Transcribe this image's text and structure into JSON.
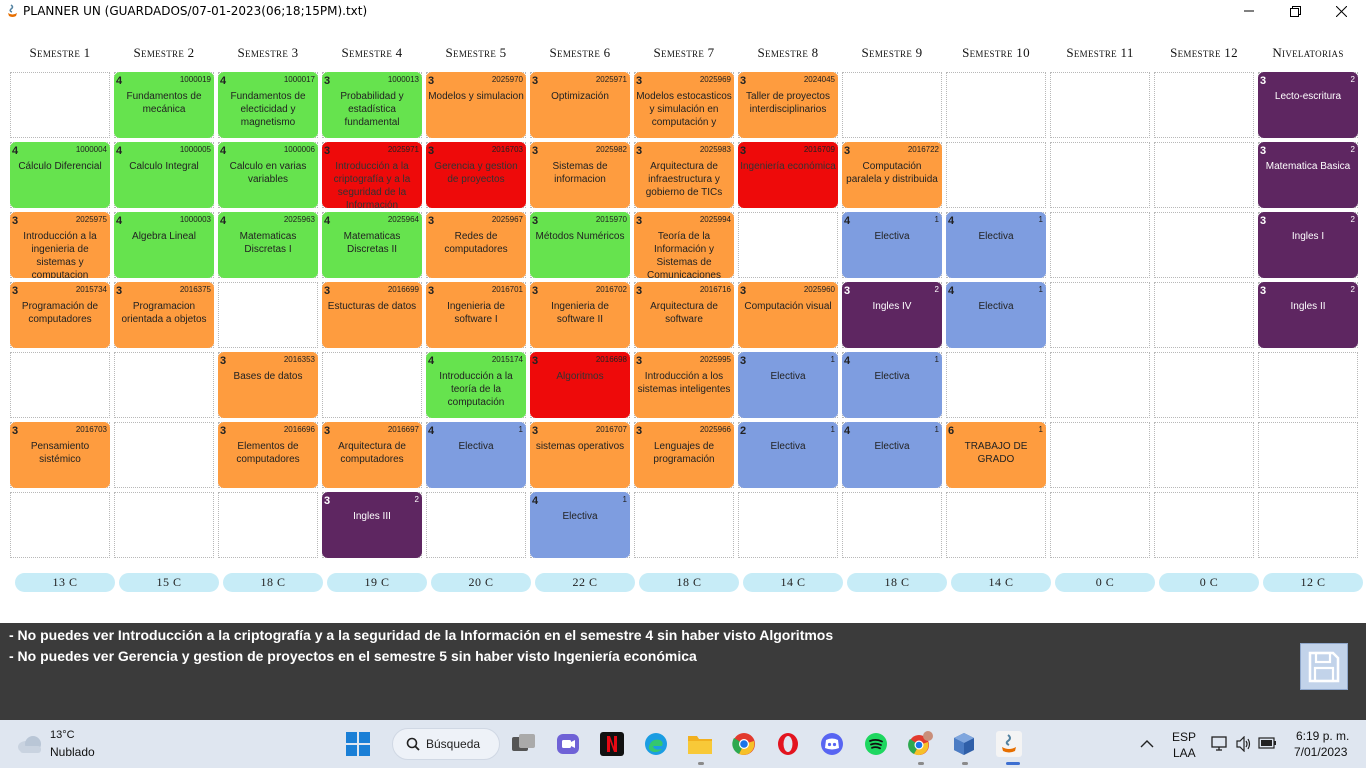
{
  "window": {
    "title": "PLANNER UN (GUARDADOS/07-01-2023(06;18;15PM).txt)"
  },
  "colors": {
    "green": "#66e34e",
    "orange": "#fe9c3f",
    "red": "#ee0a0a",
    "blue": "#7e9de0",
    "purple": "#5e2661",
    "pill": "#c7ecf7",
    "panel": "#3b3b3b"
  },
  "semesters": [
    "Semestre 1",
    "Semestre 2",
    "Semestre 3",
    "Semestre 4",
    "Semestre 5",
    "Semestre 6",
    "Semestre 7",
    "Semestre 8",
    "Semestre 9",
    "Semestre 10",
    "Semestre 11",
    "Semestre 12",
    "Nivelatorias"
  ],
  "courses": [
    {
      "col": 1,
      "row": 0,
      "credits": "4",
      "code": "1000019",
      "name": "Fundamentos de mecánica",
      "color": "green"
    },
    {
      "col": 2,
      "row": 0,
      "credits": "4",
      "code": "1000017",
      "name": "Fundamentos de electicidad y magnetismo",
      "color": "green"
    },
    {
      "col": 3,
      "row": 0,
      "credits": "3",
      "code": "1000013",
      "name": "Probabilidad y estadística fundamental",
      "color": "green"
    },
    {
      "col": 4,
      "row": 0,
      "credits": "3",
      "code": "2025970",
      "name": "Modelos y simulacion",
      "color": "orange"
    },
    {
      "col": 5,
      "row": 0,
      "credits": "3",
      "code": "2025971",
      "name": "Optimización",
      "color": "orange"
    },
    {
      "col": 6,
      "row": 0,
      "credits": "3",
      "code": "2025969",
      "name": "Modelos estocasticos y simulación en computación y",
      "color": "orange"
    },
    {
      "col": 7,
      "row": 0,
      "credits": "3",
      "code": "2024045",
      "name": "Taller de proyectos interdisciplinarios",
      "color": "orange"
    },
    {
      "col": 12,
      "row": 0,
      "credits": "3",
      "code": "2",
      "name": "Lecto-escritura",
      "color": "purple"
    },
    {
      "col": 0,
      "row": 1,
      "credits": "4",
      "code": "1000004",
      "name": "Cálculo Diferencial",
      "color": "green"
    },
    {
      "col": 1,
      "row": 1,
      "credits": "4",
      "code": "1000005",
      "name": "Calculo Integral",
      "color": "green"
    },
    {
      "col": 2,
      "row": 1,
      "credits": "4",
      "code": "1000006",
      "name": "Calculo en varias variables",
      "color": "green"
    },
    {
      "col": 3,
      "row": 1,
      "credits": "3",
      "code": "2025971",
      "name": "Introducción a la criptografía y a la seguridad de la Información",
      "color": "red"
    },
    {
      "col": 4,
      "row": 1,
      "credits": "3",
      "code": "2016703",
      "name": "Gerencia y gestion de proyectos",
      "color": "red"
    },
    {
      "col": 5,
      "row": 1,
      "credits": "3",
      "code": "2025982",
      "name": "Sistemas de informacion",
      "color": "orange"
    },
    {
      "col": 6,
      "row": 1,
      "credits": "3",
      "code": "2025983",
      "name": "Arquitectura de infraestructura y gobierno de TICs",
      "color": "orange"
    },
    {
      "col": 7,
      "row": 1,
      "credits": "3",
      "code": "2016709",
      "name": "Ingeniería económica",
      "color": "red"
    },
    {
      "col": 8,
      "row": 1,
      "credits": "3",
      "code": "2016722",
      "name": "Computación paralela y distribuida",
      "color": "orange"
    },
    {
      "col": 12,
      "row": 1,
      "credits": "3",
      "code": "2",
      "name": "Matematica Basica",
      "color": "purple"
    },
    {
      "col": 0,
      "row": 2,
      "credits": "3",
      "code": "2025975",
      "name": "Introducción a la ingenieria de sistemas y computacion",
      "color": "orange"
    },
    {
      "col": 1,
      "row": 2,
      "credits": "4",
      "code": "1000003",
      "name": "Algebra Lineal",
      "color": "green"
    },
    {
      "col": 2,
      "row": 2,
      "credits": "4",
      "code": "2025963",
      "name": "Matematicas Discretas I",
      "color": "green"
    },
    {
      "col": 3,
      "row": 2,
      "credits": "4",
      "code": "2025964",
      "name": "Matematicas Discretas II",
      "color": "green"
    },
    {
      "col": 4,
      "row": 2,
      "credits": "3",
      "code": "2025967",
      "name": "Redes de computadores",
      "color": "orange"
    },
    {
      "col": 5,
      "row": 2,
      "credits": "3",
      "code": "2015970",
      "name": "Métodos Numéricos",
      "color": "green"
    },
    {
      "col": 6,
      "row": 2,
      "credits": "3",
      "code": "2025994",
      "name": "Teoría de la Información y Sistemas de Comunicaciones",
      "color": "orange"
    },
    {
      "col": 8,
      "row": 2,
      "credits": "4",
      "code": "1",
      "name": "Electiva",
      "color": "blue"
    },
    {
      "col": 9,
      "row": 2,
      "credits": "4",
      "code": "1",
      "name": "Electiva",
      "color": "blue"
    },
    {
      "col": 12,
      "row": 2,
      "credits": "3",
      "code": "2",
      "name": "Ingles I",
      "color": "purple"
    },
    {
      "col": 0,
      "row": 3,
      "credits": "3",
      "code": "2015734",
      "name": "Programación de computadores",
      "color": "orange"
    },
    {
      "col": 1,
      "row": 3,
      "credits": "3",
      "code": "2016375",
      "name": "Programacion orientada a objetos",
      "color": "orange"
    },
    {
      "col": 3,
      "row": 3,
      "credits": "3",
      "code": "2016699",
      "name": "Estucturas de datos",
      "color": "orange"
    },
    {
      "col": 4,
      "row": 3,
      "credits": "3",
      "code": "2016701",
      "name": "Ingenieria de software I",
      "color": "orange"
    },
    {
      "col": 5,
      "row": 3,
      "credits": "3",
      "code": "2016702",
      "name": "Ingenieria de software II",
      "color": "orange"
    },
    {
      "col": 6,
      "row": 3,
      "credits": "3",
      "code": "2016716",
      "name": "Arquitectura de software",
      "color": "orange"
    },
    {
      "col": 7,
      "row": 3,
      "credits": "3",
      "code": "2025960",
      "name": "Computación visual",
      "color": "orange"
    },
    {
      "col": 8,
      "row": 3,
      "credits": "3",
      "code": "2",
      "name": "Ingles IV",
      "color": "purple"
    },
    {
      "col": 9,
      "row": 3,
      "credits": "4",
      "code": "1",
      "name": "Electiva",
      "color": "blue"
    },
    {
      "col": 12,
      "row": 3,
      "credits": "3",
      "code": "2",
      "name": "Ingles II",
      "color": "purple"
    },
    {
      "col": 2,
      "row": 4,
      "credits": "3",
      "code": "2016353",
      "name": "Bases de datos",
      "color": "orange"
    },
    {
      "col": 4,
      "row": 4,
      "credits": "4",
      "code": "2015174",
      "name": "Introducción a la teoría de la computación",
      "color": "green"
    },
    {
      "col": 5,
      "row": 4,
      "credits": "3",
      "code": "2016698",
      "name": "Algoritmos",
      "color": "red"
    },
    {
      "col": 6,
      "row": 4,
      "credits": "3",
      "code": "2025995",
      "name": "Introducción a los sistemas inteligentes",
      "color": "orange"
    },
    {
      "col": 7,
      "row": 4,
      "credits": "3",
      "code": "1",
      "name": "Electiva",
      "color": "blue"
    },
    {
      "col": 8,
      "row": 4,
      "credits": "4",
      "code": "1",
      "name": "Electiva",
      "color": "blue"
    },
    {
      "col": 0,
      "row": 5,
      "credits": "3",
      "code": "2016703",
      "name": "Pensamiento sistémico",
      "color": "orange"
    },
    {
      "col": 2,
      "row": 5,
      "credits": "3",
      "code": "2016696",
      "name": "Elementos de computadores",
      "color": "orange"
    },
    {
      "col": 3,
      "row": 5,
      "credits": "3",
      "code": "2016697",
      "name": "Arquitectura de computadores",
      "color": "orange"
    },
    {
      "col": 4,
      "row": 5,
      "credits": "4",
      "code": "1",
      "name": "Electiva",
      "color": "blue"
    },
    {
      "col": 5,
      "row": 5,
      "credits": "3",
      "code": "2016707",
      "name": "sistemas operativos",
      "color": "orange"
    },
    {
      "col": 6,
      "row": 5,
      "credits": "3",
      "code": "2025966",
      "name": "Lenguajes de programación",
      "color": "orange"
    },
    {
      "col": 7,
      "row": 5,
      "credits": "2",
      "code": "1",
      "name": "Electiva",
      "color": "blue"
    },
    {
      "col": 8,
      "row": 5,
      "credits": "4",
      "code": "1",
      "name": "Electiva",
      "color": "blue"
    },
    {
      "col": 9,
      "row": 5,
      "credits": "6",
      "code": "1",
      "name": "TRABAJO DE GRADO",
      "color": "orange"
    },
    {
      "col": 3,
      "row": 6,
      "credits": "3",
      "code": "2",
      "name": "Ingles III",
      "color": "purple"
    },
    {
      "col": 5,
      "row": 6,
      "credits": "4",
      "code": "1",
      "name": "Electiva",
      "color": "blue"
    }
  ],
  "credit_totals": [
    "13 C",
    "15 C",
    "18 C",
    "19 C",
    "20 C",
    "22 C",
    "18 C",
    "14 C",
    "18 C",
    "14 C",
    "0 C",
    "0 C",
    "12 C"
  ],
  "messages": [
    "- No puedes ver Introducción a la criptografía y a la seguridad de la Información en el semestre 4 sin haber visto Algoritmos",
    "- No puedes ver Gerencia y gestion de proyectos en el semestre 5 sin haber visto Ingeniería económica"
  ],
  "taskbar": {
    "weather_temp": "13°C",
    "weather_desc": "Nublado",
    "search_label": "Búsqueda",
    "lang_1": "ESP",
    "lang_2": "LAA",
    "time": "6:19 p. m.",
    "date": "7/01/2023"
  }
}
